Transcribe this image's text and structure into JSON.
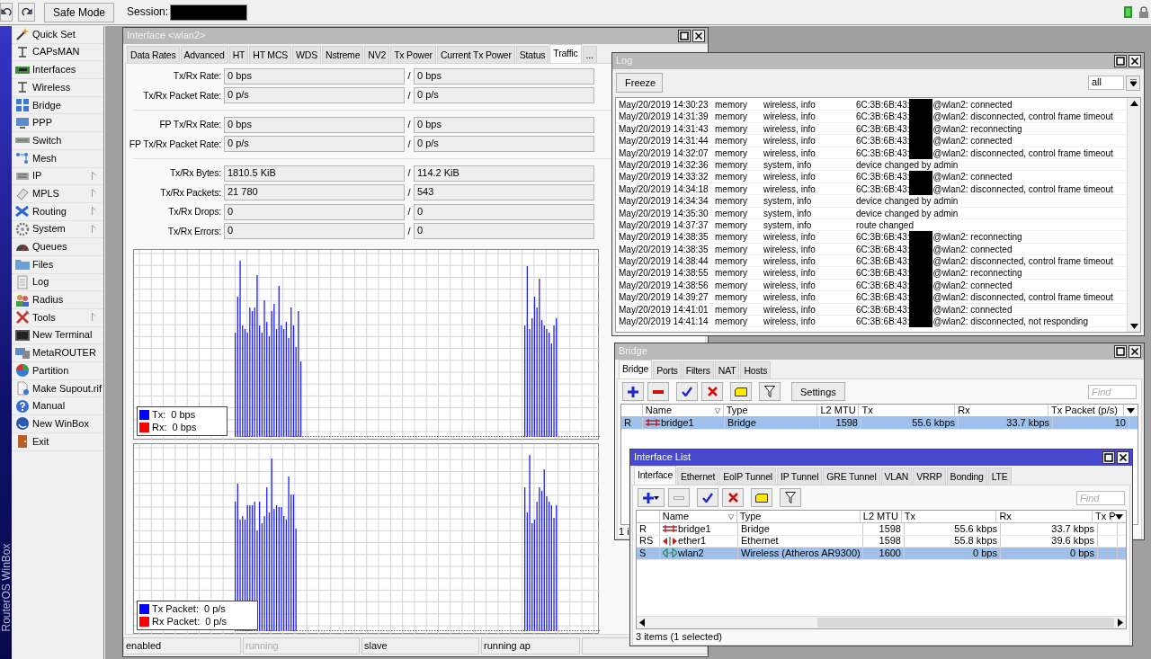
{
  "toolbar": {
    "safe_mode": "Safe Mode",
    "session_label": "Session:",
    "session_redacted": true
  },
  "sidebar": {
    "brand": "RouterOS WinBox",
    "items": [
      {
        "label": "Quick Set",
        "submenu": false
      },
      {
        "label": "CAPsMAN",
        "submenu": false
      },
      {
        "label": "Interfaces",
        "submenu": false
      },
      {
        "label": "Wireless",
        "submenu": false
      },
      {
        "label": "Bridge",
        "submenu": false
      },
      {
        "label": "PPP",
        "submenu": false
      },
      {
        "label": "Switch",
        "submenu": false
      },
      {
        "label": "Mesh",
        "submenu": false
      },
      {
        "label": "IP",
        "submenu": true
      },
      {
        "label": "MPLS",
        "submenu": true
      },
      {
        "label": "Routing",
        "submenu": true
      },
      {
        "label": "System",
        "submenu": true
      },
      {
        "label": "Queues",
        "submenu": false
      },
      {
        "label": "Files",
        "submenu": false
      },
      {
        "label": "Log",
        "submenu": false
      },
      {
        "label": "Radius",
        "submenu": false
      },
      {
        "label": "Tools",
        "submenu": true
      },
      {
        "label": "New Terminal",
        "submenu": false
      },
      {
        "label": "MetaROUTER",
        "submenu": false
      },
      {
        "label": "Partition",
        "submenu": false
      },
      {
        "label": "Make Supout.rif",
        "submenu": false
      },
      {
        "label": "Manual",
        "submenu": false
      },
      {
        "label": "New WinBox",
        "submenu": false
      },
      {
        "label": "Exit",
        "submenu": false
      }
    ]
  },
  "interface_window": {
    "title": "Interface <wlan2>",
    "active": false,
    "tabs": [
      {
        "label": "Data Rates",
        "selected": false
      },
      {
        "label": "Advanced",
        "selected": false
      },
      {
        "label": "HT",
        "selected": false
      },
      {
        "label": "HT MCS",
        "selected": false
      },
      {
        "label": "WDS",
        "selected": false
      },
      {
        "label": "Nstreme",
        "selected": false
      },
      {
        "label": "NV2",
        "selected": false
      },
      {
        "label": "Tx Power",
        "selected": false
      },
      {
        "label": "Current Tx Power",
        "selected": false
      },
      {
        "label": "Status",
        "selected": false
      },
      {
        "label": "Traffic",
        "selected": true
      },
      {
        "label": "...",
        "selected": false
      }
    ],
    "groups": [
      [
        {
          "label": "Tx/Rx Rate:",
          "tx": "0 bps",
          "sep": "/",
          "rx": "0 bps"
        },
        {
          "label": "Tx/Rx Packet Rate:",
          "tx": "0 p/s",
          "sep": "/",
          "rx": "0 p/s"
        }
      ],
      [
        {
          "label": "FP Tx/Rx Rate:",
          "tx": "0 bps",
          "sep": "/",
          "rx": "0 bps"
        },
        {
          "label": "FP Tx/Rx Packet Rate:",
          "tx": "0 p/s",
          "sep": "/",
          "rx": "0 p/s"
        }
      ],
      [
        {
          "label": "Tx/Rx Bytes:",
          "tx": "1810.5 KiB",
          "sep": "/",
          "rx": "114.2 KiB"
        },
        {
          "label": "Tx/Rx Packets:",
          "tx": "21 780",
          "sep": "/",
          "rx": "543"
        },
        {
          "label": "Tx/Rx Drops:",
          "tx": "0",
          "sep": "/",
          "rx": "0"
        },
        {
          "label": "Tx/Rx Errors:",
          "tx": "0",
          "sep": "/",
          "rx": "0"
        }
      ]
    ],
    "graphs": [
      {
        "legend": [
          {
            "label": "Tx:",
            "value": "0 bps",
            "color": "#0000ff"
          },
          {
            "label": "Rx:",
            "value": "0 bps",
            "color": "#ff0000"
          }
        ]
      },
      {
        "legend": [
          {
            "label": "Tx Packet:",
            "value": "0 p/s",
            "color": "#0000ff"
          },
          {
            "label": "Rx Packet:",
            "value": "0 p/s",
            "color": "#ff0000"
          }
        ]
      }
    ],
    "status": [
      {
        "text": "enabled",
        "disabled": false
      },
      {
        "text": "running",
        "disabled": true
      },
      {
        "text": "slave",
        "disabled": false
      },
      {
        "text": "running ap",
        "disabled": false
      }
    ]
  },
  "log_window": {
    "title": "Log",
    "freeze": "Freeze",
    "filter": "all",
    "rows": [
      {
        "time": "May/20/2019 14:30:23",
        "buffer": "memory",
        "topics": "wireless, info",
        "kind": "mac",
        "mac": "6C:3B:6B:43:",
        "message": "@wlan2: connected"
      },
      {
        "time": "May/20/2019 14:31:39",
        "buffer": "memory",
        "topics": "wireless, info",
        "kind": "mac",
        "mac": "6C:3B:6B:43:",
        "message": "@wlan2: disconnected, control frame timeout"
      },
      {
        "time": "May/20/2019 14:31:43",
        "buffer": "memory",
        "topics": "wireless, info",
        "kind": "mac",
        "mac": "6C:3B:6B:43:",
        "message": "@wlan2: reconnecting"
      },
      {
        "time": "May/20/2019 14:31:44",
        "buffer": "memory",
        "topics": "wireless, info",
        "kind": "mac",
        "mac": "6C:3B:6B:43:",
        "message": "@wlan2: connected"
      },
      {
        "time": "May/20/2019 14:32:07",
        "buffer": "memory",
        "topics": "wireless, info",
        "kind": "mac",
        "mac": "6C:3B:6B:43:",
        "message": "@wlan2: disconnected, control frame timeout"
      },
      {
        "time": "May/20/2019 14:32:36",
        "buffer": "memory",
        "topics": "system, info",
        "kind": "text",
        "message": "device changed by admin"
      },
      {
        "time": "May/20/2019 14:33:32",
        "buffer": "memory",
        "topics": "wireless, info",
        "kind": "mac",
        "mac": "6C:3B:6B:43:",
        "message": "@wlan2: connected"
      },
      {
        "time": "May/20/2019 14:34:18",
        "buffer": "memory",
        "topics": "wireless, info",
        "kind": "mac",
        "mac": "6C:3B:6B:43:",
        "message": "@wlan2: disconnected, control frame timeout"
      },
      {
        "time": "May/20/2019 14:34:34",
        "buffer": "memory",
        "topics": "system, info",
        "kind": "text",
        "message": "device changed by admin"
      },
      {
        "time": "May/20/2019 14:35:30",
        "buffer": "memory",
        "topics": "system, info",
        "kind": "text",
        "message": "device changed by admin"
      },
      {
        "time": "May/20/2019 14:37:37",
        "buffer": "memory",
        "topics": "system, info",
        "kind": "text",
        "message": "route changed"
      },
      {
        "time": "May/20/2019 14:38:35",
        "buffer": "memory",
        "topics": "wireless, info",
        "kind": "mac",
        "mac": "6C:3B:6B:43:",
        "message": "@wlan2: reconnecting"
      },
      {
        "time": "May/20/2019 14:38:35",
        "buffer": "memory",
        "topics": "wireless, info",
        "kind": "mac",
        "mac": "6C:3B:6B:43:",
        "message": "@wlan2: connected"
      },
      {
        "time": "May/20/2019 14:38:44",
        "buffer": "memory",
        "topics": "wireless, info",
        "kind": "mac",
        "mac": "6C:3B:6B:43:",
        "message": "@wlan2: disconnected, control frame timeout"
      },
      {
        "time": "May/20/2019 14:38:55",
        "buffer": "memory",
        "topics": "wireless, info",
        "kind": "mac",
        "mac": "6C:3B:6B:43:",
        "message": "@wlan2: reconnecting"
      },
      {
        "time": "May/20/2019 14:38:56",
        "buffer": "memory",
        "topics": "wireless, info",
        "kind": "mac",
        "mac": "6C:3B:6B:43:",
        "message": "@wlan2: connected"
      },
      {
        "time": "May/20/2019 14:39:27",
        "buffer": "memory",
        "topics": "wireless, info",
        "kind": "mac",
        "mac": "6C:3B:6B:43:",
        "message": "@wlan2: disconnected, control frame timeout"
      },
      {
        "time": "May/20/2019 14:41:01",
        "buffer": "memory",
        "topics": "wireless, info",
        "kind": "mac",
        "mac": "6C:3B:6B:43:",
        "message": "@wlan2: connected"
      },
      {
        "time": "May/20/2019 14:41:14",
        "buffer": "memory",
        "topics": "wireless, info",
        "kind": "mac",
        "mac": "6C:3B:6B:43:",
        "message": "@wlan2: disconnected, not responding"
      }
    ]
  },
  "bridge_window": {
    "title": "Bridge",
    "active": false,
    "tabs": [
      {
        "label": "Bridge",
        "selected": true
      },
      {
        "label": "Ports",
        "selected": false
      },
      {
        "label": "Filters",
        "selected": false
      },
      {
        "label": "NAT",
        "selected": false
      },
      {
        "label": "Hosts",
        "selected": false
      }
    ],
    "settings": "Settings",
    "find_placeholder": "Find",
    "columns": [
      "Name",
      "Type",
      "L2 MTU",
      "Tx",
      "Rx",
      "Tx Packet (p/s)"
    ],
    "rows": [
      {
        "flags": "R",
        "kind": "bridge",
        "name": "bridge1",
        "type": "Bridge",
        "l2mtu": "1598",
        "tx": "55.6 kbps",
        "rx": "33.7 kbps",
        "extra": "10",
        "selected": true
      }
    ],
    "status": "1 i"
  },
  "interface_list": {
    "title": "Interface List",
    "active": true,
    "tabs": [
      {
        "label": "Interface",
        "selected": true
      },
      {
        "label": "Ethernet",
        "selected": false
      },
      {
        "label": "EoIP Tunnel",
        "selected": false
      },
      {
        "label": "IP Tunnel",
        "selected": false
      },
      {
        "label": "GRE Tunnel",
        "selected": false
      },
      {
        "label": "VLAN",
        "selected": false
      },
      {
        "label": "VRRP",
        "selected": false
      },
      {
        "label": "Bonding",
        "selected": false
      },
      {
        "label": "LTE",
        "selected": false
      }
    ],
    "find_placeholder": "Find",
    "columns": [
      "Name",
      "Type",
      "L2 MTU",
      "Tx",
      "Rx",
      "Tx P"
    ],
    "rows": [
      {
        "flags": "R",
        "kind": "bridge",
        "name": "bridge1",
        "type": "Bridge",
        "l2mtu": "1598",
        "tx": "55.6 kbps",
        "rx": "33.7 kbps",
        "selected": false
      },
      {
        "flags": "RS",
        "kind": "ethernet",
        "name": "ether1",
        "type": "Ethernet",
        "l2mtu": "1598",
        "tx": "55.8 kbps",
        "rx": "39.6 kbps",
        "selected": false
      },
      {
        "flags": "S",
        "kind": "wireless",
        "name": "wlan2",
        "type": "Wireless (Atheros AR9300)",
        "l2mtu": "1600",
        "tx": "0 bps",
        "rx": "0 bps",
        "selected": true
      }
    ],
    "status": "3 items (1 selected)"
  }
}
